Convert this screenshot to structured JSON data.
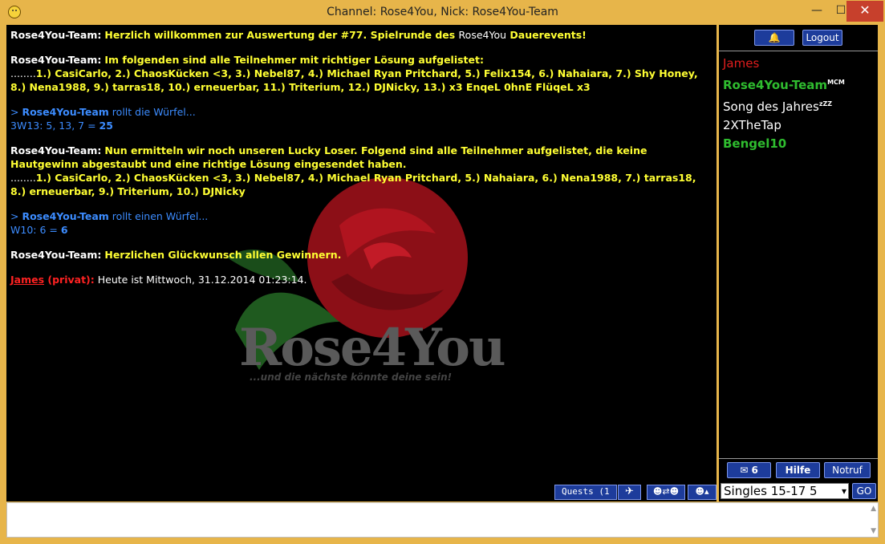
{
  "window": {
    "title": "Channel: Rose4You,  Nick: Rose4You-Team",
    "minimize": "—",
    "maximize": "☐",
    "close": "✕"
  },
  "watermark": {
    "logo": "Rose4You",
    "tagline": "...und die nächste könnte deine sein!"
  },
  "messages": [
    {
      "nick": "Rose4You-Team:",
      "text": "Herzlich willkommen zur Auswertung der #77. Spielrunde des ",
      "mid": "Rose4You",
      "end": " Dauerevents!"
    },
    {
      "nick": "Rose4You-Team:",
      "line1": "Im folgenden sind alle Teilnehmer mit richtiger Lösung aufgelistet:",
      "dots": "........",
      "line2": "1.) CasiCarlo, 2.) ChaosKücken <3, 3.) Nebel87, 4.) Michael Ryan Pritchard, 5.) Felix154, 6.) Nahaiara, 7.) Shy Honey, 8.) Nena1988, 9.) tarras18, 10.) erneuerbar, 11.) Triterium, 12.) DJNicky, 13.) x3 EnqeL 0hnE FlüqeL x3"
    },
    {
      "prefix": "> ",
      "nick": "Rose4You-Team",
      "text": " rollt die Würfel...",
      "result": "3W13: 5, 13, 7 = ",
      "sum": "25"
    },
    {
      "nick": "Rose4You-Team:",
      "line1": "Nun ermitteln wir noch unseren Lucky Loser. Folgend sind alle Teilnehmer aufgelistet, die keine Hautgewinn abgestaubt und eine richtige Lösung eingesendet haben.",
      "dots": "........",
      "line2": "1.) CasiCarlo, 2.) ChaosKücken <3, 3.) Nebel87, 4.) Michael Ryan Pritchard, 5.) Nahaiara, 6.) Nena1988, 7.) tarras18, 8.) erneuerbar, 9.) Triterium, 10.) DJNicky"
    },
    {
      "prefix": "> ",
      "nick": "Rose4You-Team",
      "text": " rollt einen Würfel...",
      "result": "W10: 6 = ",
      "sum": "6"
    },
    {
      "nick": "Rose4You-Team:",
      "text": "Herzlichen Glückwunsch allen Gewinnern."
    },
    {
      "nick": "James",
      "tag": " (privat):",
      "text": " Heute ist Mittwoch, 31.12.2014 01:23:14."
    }
  ],
  "toolbar": {
    "quests": "Quests  (1",
    "plane_icon": "✈",
    "smileys": "☻⇄☻",
    "smiley_up": "☻▴"
  },
  "sidebar": {
    "bell_icon": "🔔",
    "logout": "Logout",
    "users": [
      {
        "name": "James",
        "badge": ""
      },
      {
        "name": "Rose4You-Team",
        "badge": "MCM"
      },
      {
        "name": "Song des Jahres",
        "badge": "zZZ"
      },
      {
        "name": "2XTheTap",
        "badge": ""
      },
      {
        "name": "Bengel10",
        "badge": ""
      }
    ],
    "mail_icon": "✉",
    "mail_count": "6",
    "hilfe": "Hilfe",
    "notruf": "Notruf",
    "channel_select": "Singles 15-17 5",
    "go": "GO"
  },
  "input": {
    "placeholder": ""
  },
  "colors": {
    "chat_bg": "#000000",
    "frame": "#e7b54a",
    "button": "#1d3c9b",
    "yellow": "#ffff33",
    "blue": "#3c8cff",
    "red": "#ff2222",
    "green": "#2fbd2f"
  }
}
